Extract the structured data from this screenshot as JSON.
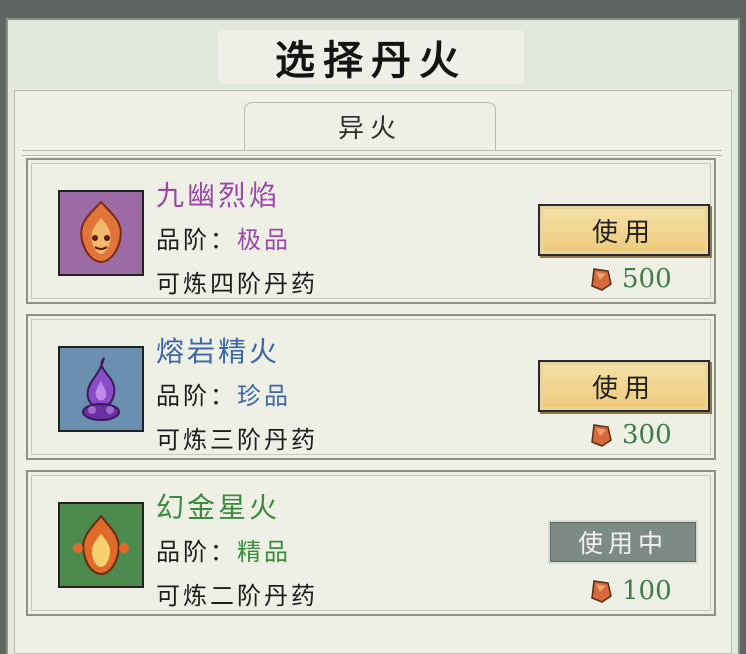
{
  "title": "选择丹火",
  "tab": {
    "label": "异火"
  },
  "fires": [
    {
      "name": "九幽烈焰",
      "name_color": "#9a4aa6",
      "icon": "orange-flame-face-icon",
      "icon_bg": "#9c6aa5",
      "grade_label": "品阶：",
      "grade": "极品",
      "grade_color": "#9a4aa6",
      "refine": "可炼四阶丹药",
      "action": "使用",
      "action_state": "available",
      "cost": "500",
      "cost_icon": "spirit-stone-icon"
    },
    {
      "name": "熔岩精火",
      "name_color": "#3f67a6",
      "icon": "purple-flame-icon",
      "icon_bg": "#6b8fb0",
      "grade_label": "品阶：",
      "grade": "珍品",
      "grade_color": "#3f67a6",
      "refine": "可炼三阶丹药",
      "action": "使用",
      "action_state": "available",
      "cost": "300",
      "cost_icon": "spirit-stone-icon"
    },
    {
      "name": "幻金星火",
      "name_color": "#3c8a3c",
      "icon": "gold-flame-icon",
      "icon_bg": "#4d8a4d",
      "grade_label": "品阶：",
      "grade": "精品",
      "grade_color": "#3c8a3c",
      "refine": "可炼二阶丹药",
      "action": "使用中",
      "action_state": "in-use",
      "cost": "100",
      "cost_icon": "spirit-stone-icon"
    }
  ]
}
